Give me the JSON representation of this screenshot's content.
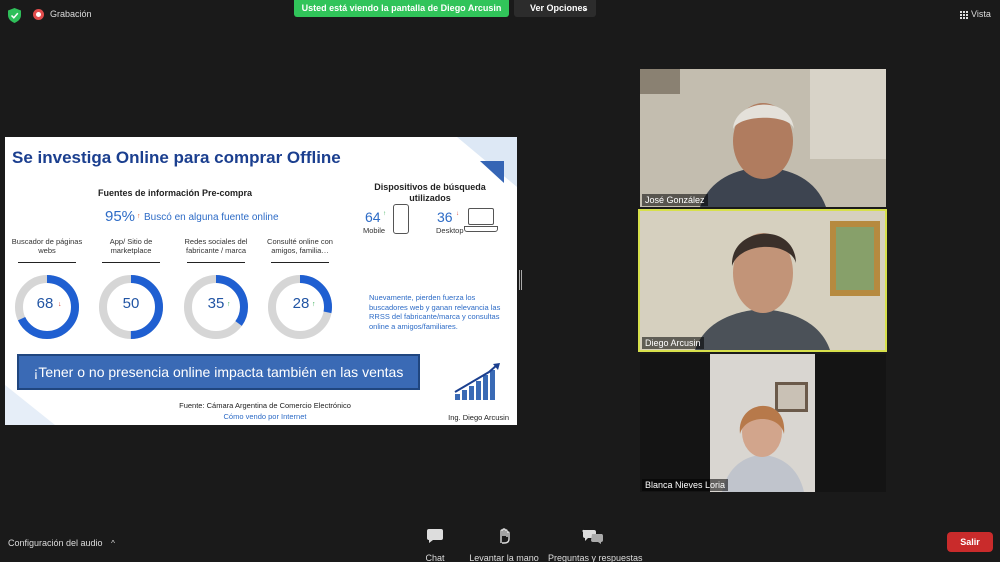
{
  "topbar": {
    "recording_label": "Grabación",
    "share_banner": "Usted está viendo la pantalla de Diego Arcusin",
    "view_options": "Ver Opciones",
    "view_label": "Vista"
  },
  "slide": {
    "title": "Se investiga Online para comprar Offline",
    "subtitle": "Fuentes de información Pre-compra",
    "overall_percent": "95%",
    "overall_text": "Buscó en alguna fuente online",
    "sources": [
      {
        "label": "Buscador de páginas webs",
        "value": "68",
        "trend": "down"
      },
      {
        "label": "App/ Sitio de marketplace",
        "value": "50",
        "trend": "none"
      },
      {
        "label": "Redes sociales del fabricante / marca",
        "value": "35",
        "trend": "up"
      },
      {
        "label": "Consulté online con amigos, familia…",
        "value": "28",
        "trend": "up"
      }
    ],
    "devices_title": "Dispositivos de búsqueda utilizados",
    "devices": [
      {
        "label": "Mobile",
        "value": "64",
        "trend": "up"
      },
      {
        "label": "Desktop",
        "value": "36",
        "trend": "down"
      }
    ],
    "note": "Nuevamente, pierden fuerza los buscadores web y ganan relevancia las RRSS del fabricante/marca y consultas online a amigos/familiares.",
    "banner": "¡Tener o no presencia online impacta también en las ventas físicas!",
    "source_line": "Fuente: Cámara Argentina de Comercio Electrónico",
    "source_link": "Cómo vendo por Internet",
    "author": "Ing. Diego Arcusin"
  },
  "participants": [
    {
      "name": "José González"
    },
    {
      "name": "Diego Arcusin"
    },
    {
      "name": "Blanca Nieves Loria"
    }
  ],
  "bottombar": {
    "audio_config": "Configuración del audio",
    "chat": "Chat",
    "raise_hand": "Levantar la mano",
    "qa": "Preguntas y respuestas",
    "exit": "Salir"
  },
  "colors": {
    "share_green": "#31c45a",
    "exit_red": "#c92b2b",
    "active_speaker": "#d7e04b",
    "slide_blue": "#2d6bc6",
    "donut_fill": "#1f5fd1",
    "donut_track": "#d6d6d6"
  }
}
